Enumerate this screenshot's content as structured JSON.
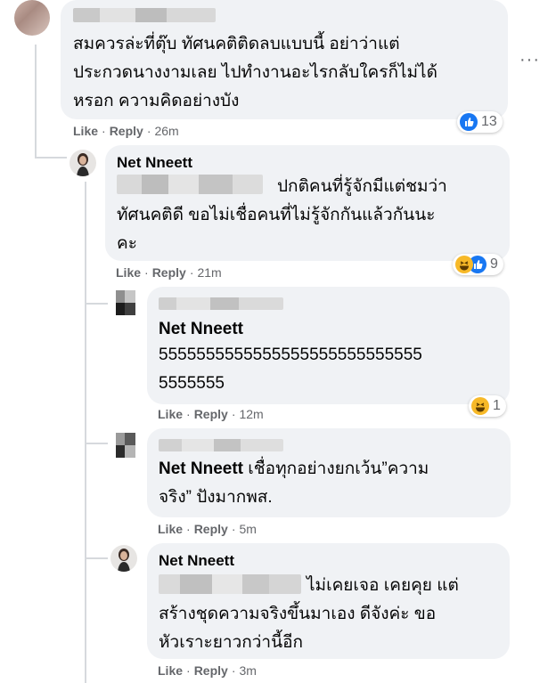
{
  "colors": {
    "bubble": "#f0f2f5",
    "meta": "#65676b",
    "like_blue": "#1877f2",
    "haha_yellow": "#f7b928"
  },
  "comments": [
    {
      "text_lines": [
        "สมควรล่ะที่ตุ๊บ ทัศนคติติดลบแบบนี้ อย่าว่าแต่",
        "ประกวดนางงามเลย ไปทำงานอะไรกลับใครก็ไม่ได้",
        "หรอก ความคิดอย่างบัง"
      ],
      "like": "Like",
      "reply": "Reply",
      "time": "26m",
      "reaction_count": "13",
      "reaction_icons": [
        "like-icon"
      ]
    },
    {
      "author": "Net Nneett",
      "text_lines": [
        "ปกติคนที่รู้จักมีแต่ชมว่า",
        "ทัศนคติดี ขอไม่เชื่อคนที่ไม่รู้จักกันแล้วกันนะ",
        "คะ"
      ],
      "like": "Like",
      "reply": "Reply",
      "time": "21m",
      "reaction_count": "9",
      "reaction_icons": [
        "haha-icon",
        "like-icon"
      ]
    },
    {
      "author": "Net Nneett",
      "text_lines": [
        "5555555555555555555555555555",
        "5555555"
      ],
      "like": "Like",
      "reply": "Reply",
      "time": "12m",
      "reaction_count": "1",
      "reaction_icons": [
        "haha-icon"
      ]
    },
    {
      "inline_author": "Net Nneett",
      "text_first": "เชื่อทุกอย่างยกเว้น”ความ",
      "text_lines": [
        "จริง” ปังมากพส."
      ],
      "like": "Like",
      "reply": "Reply",
      "time": "5m"
    },
    {
      "author": "Net Nneett",
      "text_lines": [
        "ไม่เคยเจอ เคยคุย แต่",
        "สร้างชุดความจริงขึ้นมาเอง ดีจังค่ะ ขอ",
        "หัวเราะยาวกว่านี้อีก"
      ],
      "like": "Like",
      "reply": "Reply",
      "time": "3m"
    }
  ],
  "more_icon": "more-options-icon",
  "more_glyph": "···"
}
